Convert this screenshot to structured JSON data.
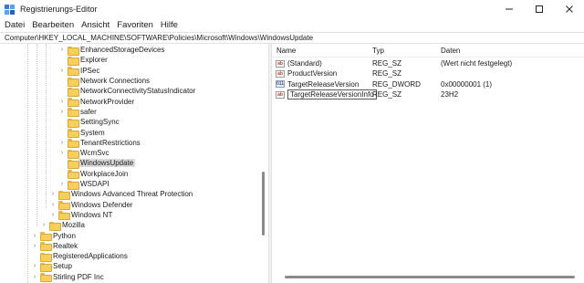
{
  "window": {
    "title": "Registrierungs-Editor",
    "app_icon": "regedit-icon",
    "controls": [
      "minimize",
      "maximize",
      "close"
    ]
  },
  "menu": [
    "Datei",
    "Bearbeiten",
    "Ansicht",
    "Favoriten",
    "Hilfe"
  ],
  "address": "Computer\\HKEY_LOCAL_MACHINE\\SOFTWARE\\Policies\\Microsoft\\Windows\\WindowsUpdate",
  "tree": {
    "items": [
      {
        "label": "EnhancedStorageDevices",
        "expandable": true,
        "selected": false
      },
      {
        "label": "Explorer",
        "expandable": false,
        "selected": false
      },
      {
        "label": "IPSec",
        "expandable": true,
        "selected": false
      },
      {
        "label": "Network Connections",
        "expandable": false,
        "selected": false
      },
      {
        "label": "NetworkConnectivityStatusIndicator",
        "expandable": false,
        "selected": false
      },
      {
        "label": "NetworkProvider",
        "expandable": true,
        "selected": false
      },
      {
        "label": "safer",
        "expandable": true,
        "selected": false
      },
      {
        "label": "SettingSync",
        "expandable": false,
        "selected": false
      },
      {
        "label": "System",
        "expandable": false,
        "selected": false
      },
      {
        "label": "TenantRestrictions",
        "expandable": true,
        "selected": false
      },
      {
        "label": "WcmSvc",
        "expandable": true,
        "selected": false
      },
      {
        "label": "WindowsUpdate",
        "expandable": false,
        "selected": true
      },
      {
        "label": "WorkplaceJoin",
        "expandable": false,
        "selected": false
      },
      {
        "label": "WSDAPI",
        "expandable": true,
        "selected": false
      },
      {
        "label": "Windows Advanced Threat Protection",
        "expandable": true,
        "selected": false
      },
      {
        "label": "Windows Defender",
        "expandable": true,
        "selected": false
      },
      {
        "label": "Windows NT",
        "expandable": true,
        "selected": false
      },
      {
        "label": "Mozilla",
        "expandable": true,
        "selected": false
      },
      {
        "label": "Python",
        "expandable": true,
        "selected": false
      },
      {
        "label": "Realtek",
        "expandable": true,
        "selected": false
      },
      {
        "label": "RegisteredApplications",
        "expandable": false,
        "selected": false
      },
      {
        "label": "Setup",
        "expandable": true,
        "selected": false
      },
      {
        "label": "Stirling PDF Inc",
        "expandable": true,
        "selected": false
      }
    ]
  },
  "list": {
    "headers": {
      "name": "Name",
      "type": "Typ",
      "data": "Daten"
    },
    "rows": [
      {
        "icon": "string-value-icon",
        "name": "(Standard)",
        "type": "REG_SZ",
        "data": "(Wert nicht festgelegt)",
        "editing": false
      },
      {
        "icon": "string-value-icon",
        "name": "ProductVersion",
        "type": "REG_SZ",
        "data": "",
        "editing": false
      },
      {
        "icon": "dword-value-icon",
        "name": "TargetReleaseVersion",
        "type": "REG_DWORD",
        "data": "0x00000001 (1)",
        "editing": false
      },
      {
        "icon": "string-value-icon",
        "name": "TargetReleaseVersionInfo",
        "type": "REG_SZ",
        "data": "23H2",
        "editing": true
      }
    ]
  },
  "colors": {
    "selection": "#d9d9d9",
    "folder": "#f7cf5a",
    "string_icon": "#c0392b",
    "dword_icon": "#2c5ba8"
  }
}
